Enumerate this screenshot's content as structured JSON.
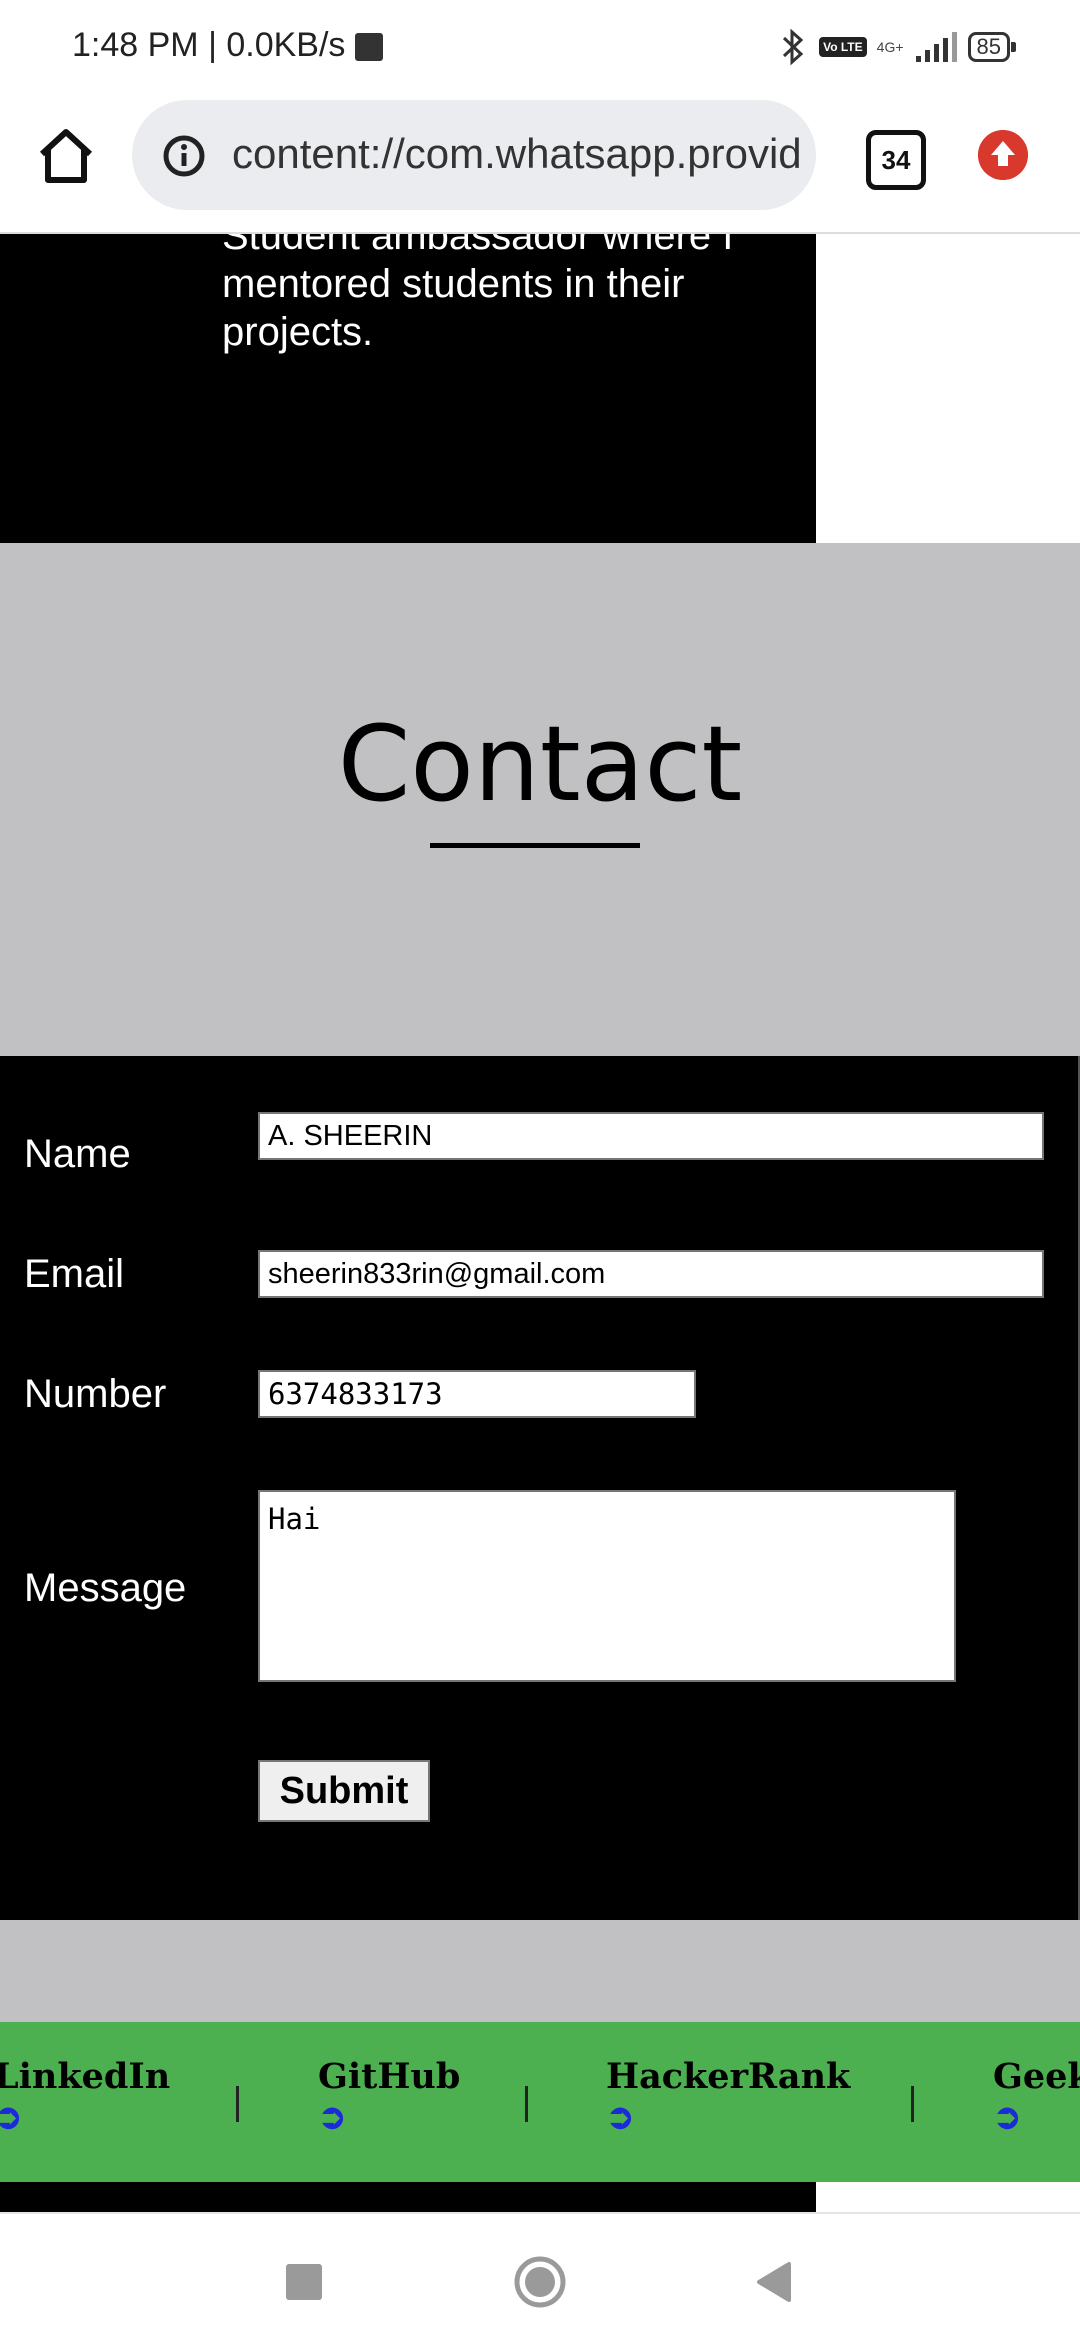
{
  "status_bar": {
    "time": "1:48 PM | 0.0KB/s",
    "network": "4G+",
    "volte": "Vo LTE",
    "battery": "85",
    "icons": [
      "stop-icon",
      "bluetooth-icon",
      "volte-icon",
      "signal-icon",
      "battery-icon"
    ]
  },
  "browser": {
    "url": "content://com.whatsapp.provider.media/item/...",
    "tab_count": "34",
    "icons": [
      "home-icon",
      "info-icon",
      "tabs-icon",
      "update-icon"
    ]
  },
  "experience": {
    "text": "Student ambassador where I mentored students in their projects."
  },
  "contact": {
    "title": "Contact"
  },
  "form": {
    "name_label": "Name",
    "name_value": "A. SHEERIN",
    "email_label": "Email",
    "email_value": "sheerin833rin@gmail.com",
    "number_label": "Number",
    "number_value": "6374833173",
    "message_label": "Message",
    "message_value": "Hai",
    "submit_label": "Submit"
  },
  "links": [
    {
      "name": "LinkedIn",
      "arrow": "➲"
    },
    {
      "name": "GitHub",
      "arrow": "➲"
    },
    {
      "name": "HackerRank",
      "arrow": "➲"
    },
    {
      "name": "GeeksforGeeks",
      "arrow": "➲"
    }
  ],
  "colors": {
    "link_bar": "#4caf50",
    "contact_bg": "#c1c0c2",
    "form_bg": "#000000",
    "update_badge": "#d9382c"
  }
}
